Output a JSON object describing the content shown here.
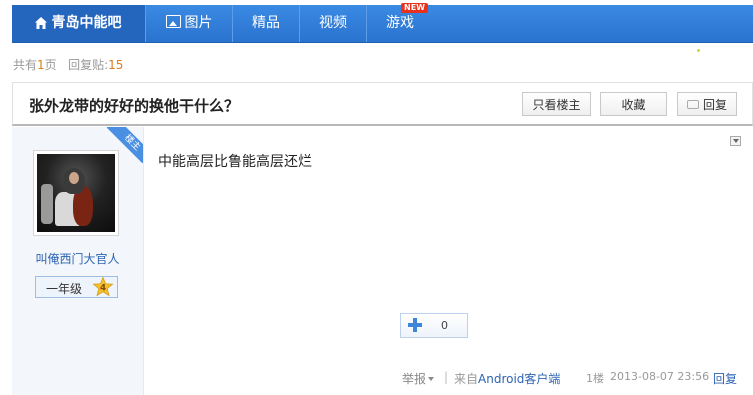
{
  "nav": {
    "home_label": "青岛中能吧",
    "pictures_label": "图片",
    "featured_label": "精品",
    "video_label": "视频",
    "games_label": "游戏",
    "new_badge": "NEW"
  },
  "meta": {
    "pages_prefix": "共有",
    "pages_count": "1",
    "pages_suffix": "页",
    "replies_label": "回复贴:",
    "replies_count": "15"
  },
  "thread": {
    "title": "张外龙带的好好的换他干什么？",
    "only_op_label": "只看楼主",
    "favorite_label": "收藏",
    "reply_label": "回复"
  },
  "post": {
    "op_badge": "楼主",
    "username": "叫俺西门大官人",
    "level_name": "一年级",
    "level_number": "4",
    "content": "中能高层比鲁能高层还烂",
    "like_count": "0",
    "report_label": "举报",
    "separator": "|",
    "from_label": "来自",
    "client_link": "Android客户端",
    "floor": "1楼",
    "timestamp": "2013-08-07 23:56",
    "reply_label": "回复"
  },
  "colors": {
    "nav_bg": "#2f7fd8",
    "link": "#2d64b3",
    "accent_orange": "#e07b1a",
    "new_badge": "#e8321e"
  }
}
